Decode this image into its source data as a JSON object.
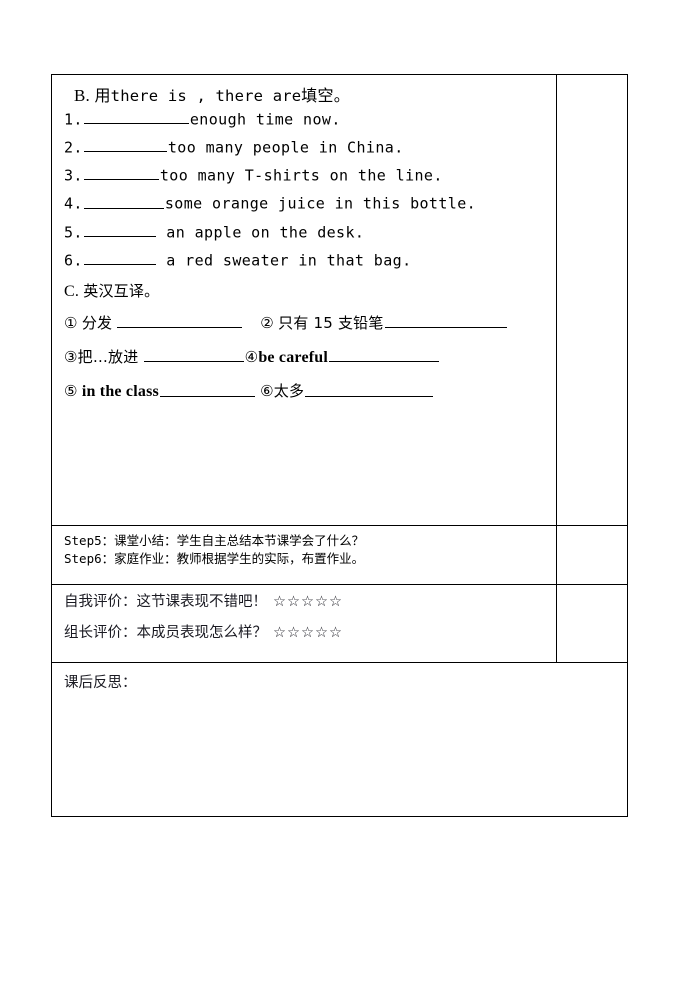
{
  "document": {
    "type": "worksheet",
    "language": "zh-CN/en"
  },
  "section_b": {
    "heading_label": "B.",
    "heading_cjk_1": "用",
    "heading_en": "there  is ,  there  are",
    "heading_cjk_2": "填空。",
    "items": [
      {
        "num": "1.",
        "after": "enough  time now."
      },
      {
        "num": "2.",
        "after": "too  many  people  in  China."
      },
      {
        "num": "3.",
        "after": "too  many  T-shirts  on  the  line."
      },
      {
        "num": "4.",
        "after": "some  orange  juice  in  this  bottle."
      },
      {
        "num": "5.",
        "after": " an  apple  on  the  desk."
      },
      {
        "num": "6.",
        "after": " a  red  sweater  in  that  bag."
      }
    ]
  },
  "section_c": {
    "heading_label": "C.",
    "heading_cjk": "英汉互译。",
    "items": [
      {
        "marker": "①",
        "text": "分发",
        "lang": "cjk"
      },
      {
        "marker": "②",
        "text": "只有 15 支铅笔",
        "lang": "cjk"
      },
      {
        "marker": "③",
        "text": "把…放进",
        "lang": "cjk"
      },
      {
        "marker": "④",
        "text": "be careful",
        "lang": "en"
      },
      {
        "marker": "⑤",
        "text": "in the class",
        "lang": "en"
      },
      {
        "marker": "⑥",
        "text": "太多",
        "lang": "cjk"
      }
    ]
  },
  "steps": {
    "line1": "Step5：课堂小结：学生自主总结本节课学会了什么？",
    "line2": "Step6：家庭作业：教师根据学生的实际，布置作业。"
  },
  "evaluation": {
    "self": {
      "label": "自我评价：这节课表现不错吧！",
      "stars": "☆☆☆☆☆",
      "star_count": 5
    },
    "leader": {
      "label": "组长评价：本成员表现怎么样？",
      "stars": "☆☆☆☆☆",
      "star_count": 5
    }
  },
  "reflection": {
    "label": "课后反思："
  }
}
